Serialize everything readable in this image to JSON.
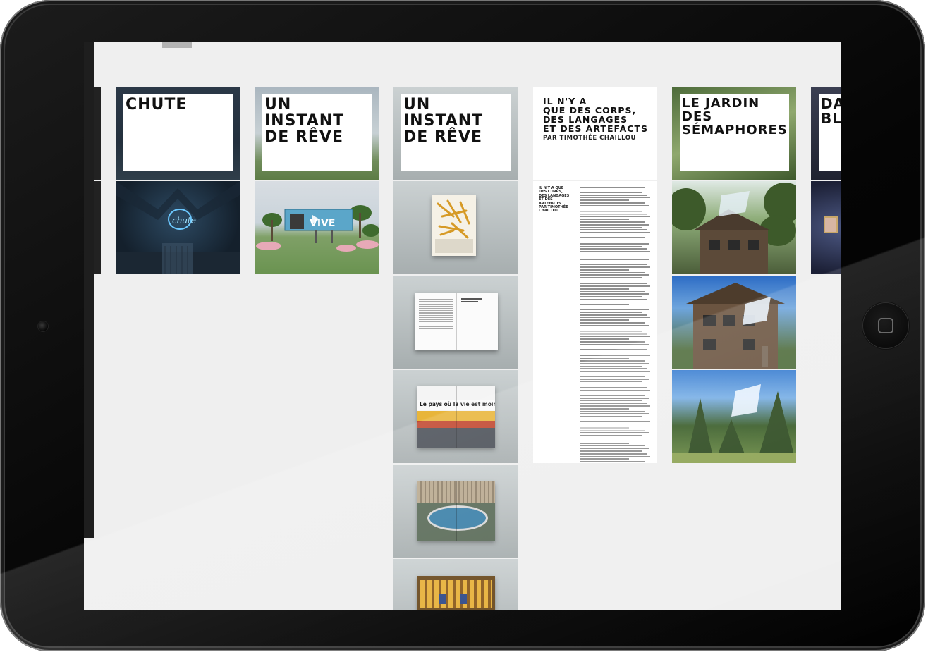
{
  "device": {
    "frame": "tablet",
    "home_button_icon": "home-square-icon",
    "camera": "front-camera"
  },
  "colors": {
    "frame": "#0a0a0a",
    "screen_bg": "#efefef",
    "title_text": "#111111",
    "title_box": "#ffffff"
  },
  "columns": [
    {
      "id": "chute",
      "title": "CHUTE"
    },
    {
      "id": "instant1",
      "title": "UN\nINSTANT\nDE RÊVE",
      "billboard_text": "VIVE"
    },
    {
      "id": "instant2",
      "title": "UN\nINSTANT\nDE RÊVE",
      "book_headline": "Le pays où la vie est moins chère"
    },
    {
      "id": "article",
      "title": "IL N'Y A\nQUE DES CORPS,\nDES LANGAGES\nET DES ARTEFACTS",
      "byline": "PAR TIMOTHÉE CHAILLOU",
      "mini_title": "IL N'Y A QUE\nDES CORPS,\nDES LANGAGES\nET DES ARTEFACTS\nPAR TIMOTHÉE\nCHAILLOU"
    },
    {
      "id": "jardin",
      "title": "LE JARDIN\nDES\nSÉMAPHORES"
    },
    {
      "id": "partial",
      "title": "DA\nBL"
    }
  ],
  "neon_text": "chute"
}
